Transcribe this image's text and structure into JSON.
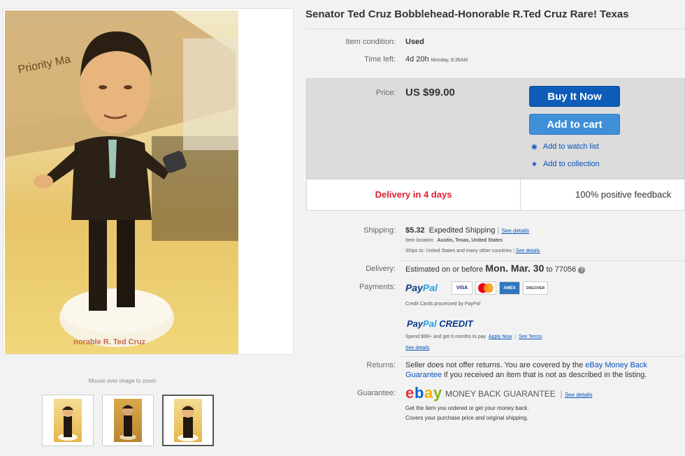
{
  "gallery": {
    "zoom_hint": "Mouse over image to zoom",
    "photo_base_text": "norable R. Ted Cruz",
    "box_text": "Priority Ma"
  },
  "listing": {
    "title": "Senator Ted Cruz Bobblehead-Honorable R.Ted Cruz Rare! Texas",
    "condition_label": "Item condition:",
    "condition_value": "Used",
    "time_left_label": "Time left:",
    "time_left_value": "4d 20h",
    "time_left_day": "Monday, 8:36AM"
  },
  "purchase": {
    "price_label": "Price:",
    "price_value": "US $99.00",
    "buy_now": "Buy It Now",
    "add_to_cart": "Add to cart",
    "watch_list": "Add to watch list",
    "collection": "Add to collection",
    "delivery_days": "Delivery in 4 days",
    "feedback": "100% positive feedback"
  },
  "shipping": {
    "label": "Shipping:",
    "cost": "$5.32",
    "method": "Expedited Shipping",
    "separator": "|",
    "details_link": "See details",
    "location_label": "Item location:",
    "location": "Austin, Texas, United States",
    "ships_to_label": "Ships to:",
    "ships_to": "United States and many other countries",
    "ships_details": "See details"
  },
  "delivery": {
    "label": "Delivery:",
    "prefix": "Estimated on or before",
    "date": "Mon. Mar. 30",
    "to": "to",
    "zip": "77056"
  },
  "payments": {
    "label": "Payments:",
    "paypal_pay": "Pay",
    "paypal_pal": "Pal",
    "cards": [
      "VISA",
      "MC",
      "AMEX",
      "DISCOVER"
    ],
    "credit_note": "Credit Cards processed by PayPal",
    "credit_brand": "CREDIT",
    "credit_offer": "Spend $99+ and get 6 months to pay",
    "apply_now": "Apply Now",
    "see_terms": "See Terms",
    "see_details": "See details"
  },
  "returns": {
    "label": "Returns:",
    "line1_text": "Seller does not offer returns. You are covered by the",
    "line1_link": "eBay Money Back",
    "line2_link": "Guarantee",
    "line2_text": "if you received an item that is not as described in the listing."
  },
  "guarantee": {
    "label": "Guarantee:",
    "mbg": "MONEY BACK GUARANTEE",
    "see_details": "See details",
    "line1": "Get the item you ordered or get your money back.",
    "line2": "Covers your purchase price and original shipping."
  },
  "colors": {
    "buy_now": "#0e5cb8",
    "add_to_cart": "#3f8fd9",
    "delivery_red": "#dd1e31",
    "link_blue": "#0654ba"
  }
}
